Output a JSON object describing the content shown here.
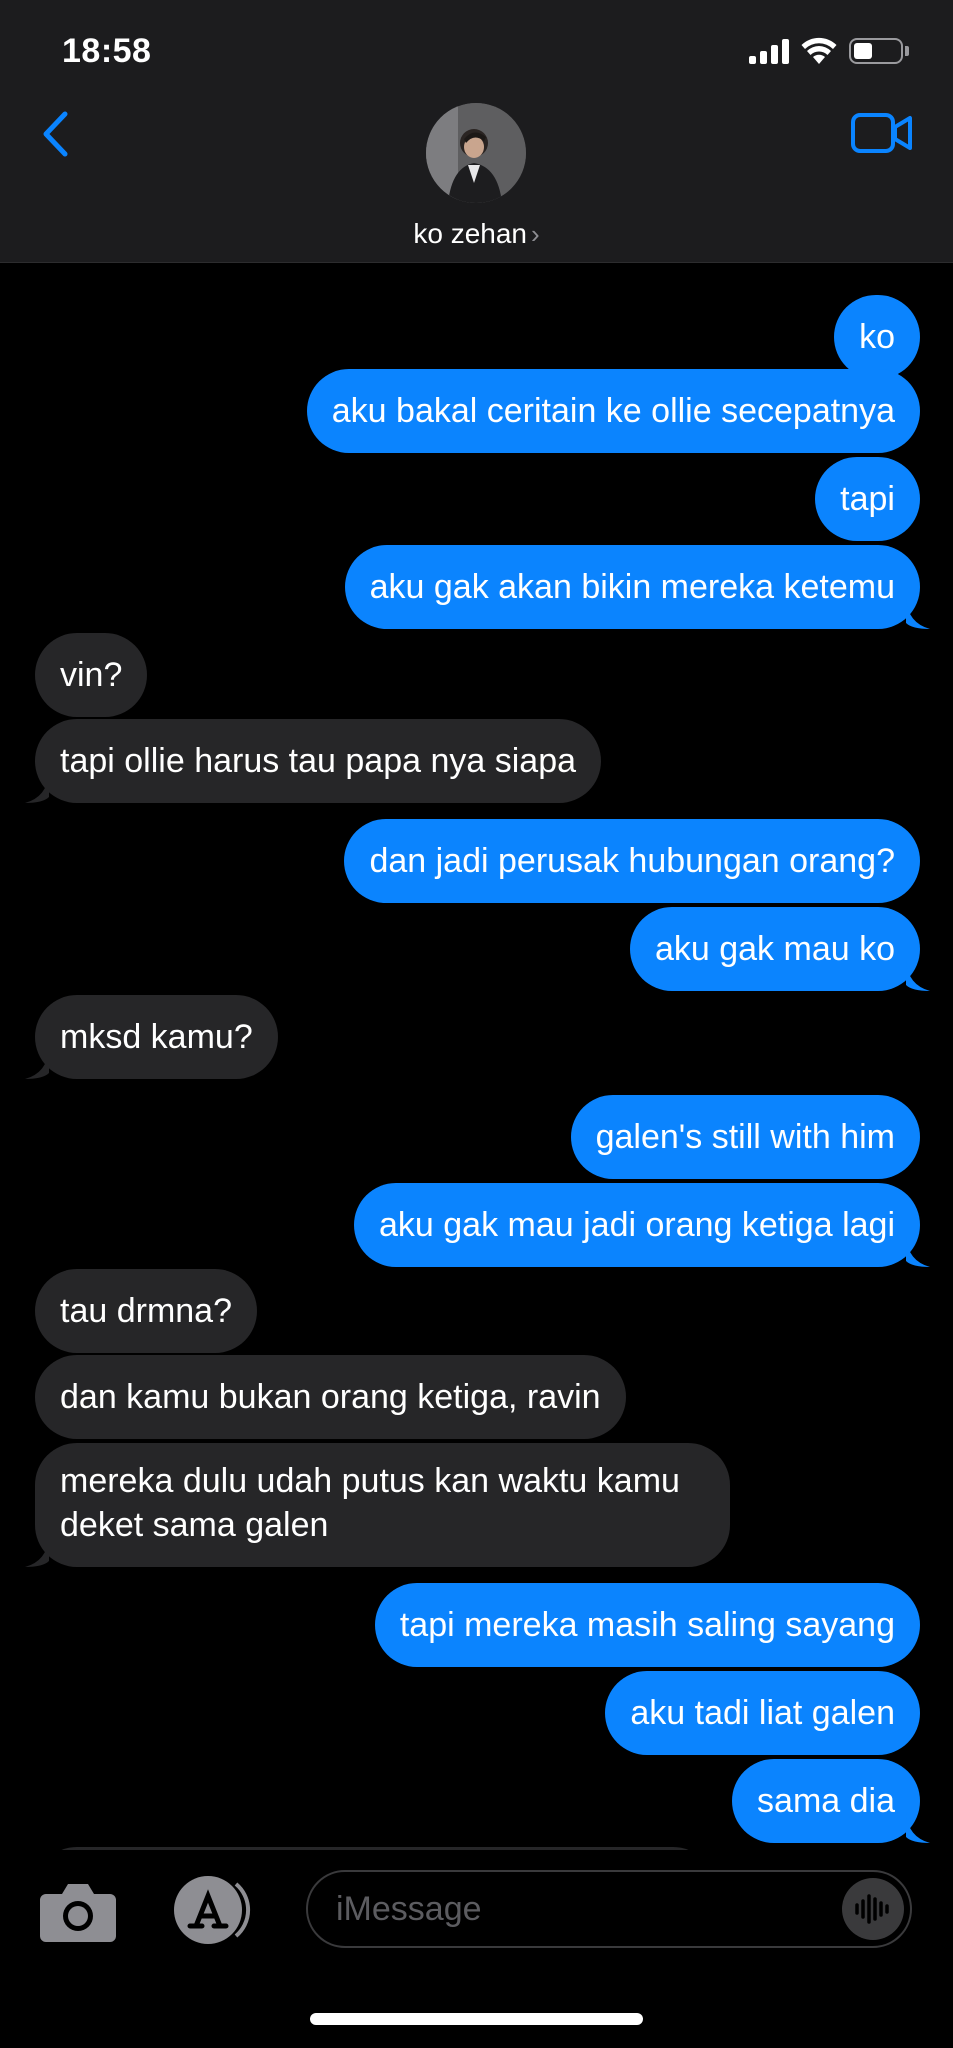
{
  "status_bar": {
    "time": "18:58"
  },
  "header": {
    "contact_name": "ko zehan",
    "chevron": "›",
    "icons": {
      "back": "chevron-left-icon",
      "video": "video-camera-icon"
    }
  },
  "colors": {
    "sent_bubble": "#0b84fe",
    "received_bubble": "#262628",
    "accent": "#0a84ff",
    "header_bg": "#1c1c1e"
  },
  "messages": [
    {
      "side": "sent",
      "text": "ko"
    },
    {
      "side": "sent",
      "text": "aku bakal ceritain ke ollie secepatnya"
    },
    {
      "side": "sent",
      "text": "tapi"
    },
    {
      "side": "sent",
      "text": "aku gak akan bikin mereka ketemu"
    },
    {
      "side": "received",
      "text": "vin?"
    },
    {
      "side": "received",
      "text": "tapi ollie harus tau papa nya siapa"
    },
    {
      "side": "sent",
      "text": "dan jadi perusak hubungan orang?"
    },
    {
      "side": "sent",
      "text": "aku gak mau ko"
    },
    {
      "side": "received",
      "text": "mksd kamu?"
    },
    {
      "side": "sent",
      "text": "galen's still with him"
    },
    {
      "side": "sent",
      "text": "aku gak mau jadi orang ketiga lagi"
    },
    {
      "side": "received",
      "text": "tau drmna?"
    },
    {
      "side": "received",
      "text": "dan kamu bukan orang ketiga, ravin"
    },
    {
      "side": "received",
      "text": "mereka dulu udah putus kan waktu kamu deket sama galen"
    },
    {
      "side": "sent",
      "text": "tapi mereka masih saling sayang"
    },
    {
      "side": "sent",
      "text": "aku tadi liat galen"
    },
    {
      "side": "sent",
      "text": "sama dia"
    }
  ],
  "composer": {
    "placeholder": "iMessage",
    "icons": {
      "camera": "camera-icon",
      "apps": "app-store-icon",
      "audio": "audio-waveform-icon"
    }
  }
}
